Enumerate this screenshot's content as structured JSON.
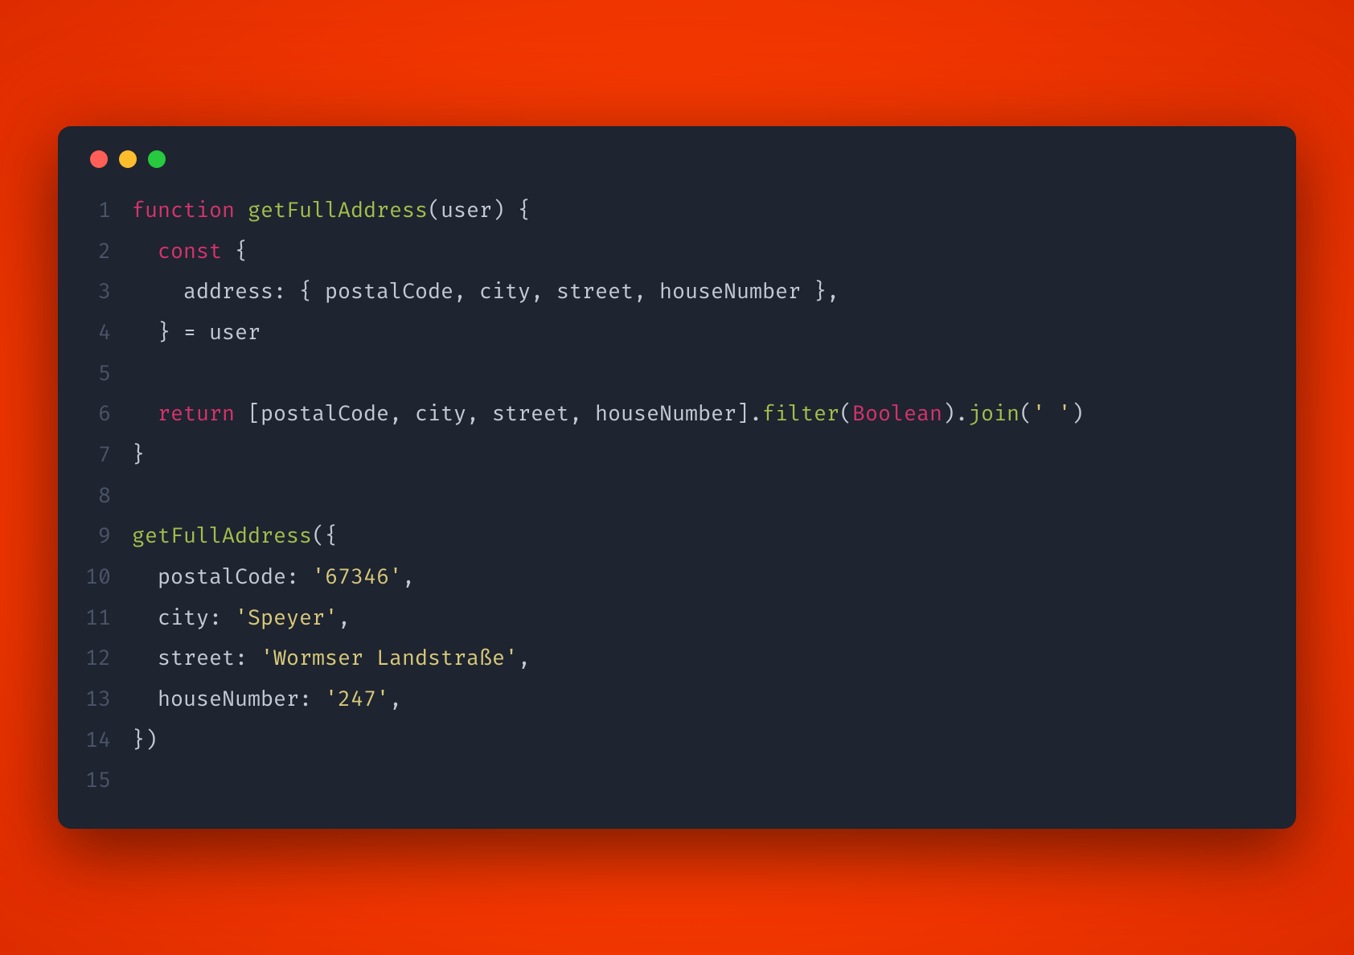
{
  "colors": {
    "background_gradient_inner": "#ff5722",
    "background_gradient_outer": "#dd2c00",
    "window_bg": "#1e2430",
    "line_number": "#4b5568",
    "default_text": "#c3c9d5",
    "keyword": "#d6336c",
    "function_name": "#a3be4c",
    "string": "#d8c97a",
    "traffic_red": "#ff5f56",
    "traffic_yellow": "#ffbd2e",
    "traffic_green": "#27c93f"
  },
  "code_lines": [
    {
      "n": 1,
      "tokens": [
        [
          "kw",
          "function"
        ],
        [
          "punct",
          " "
        ],
        [
          "fn",
          "getFullAddress"
        ],
        [
          "punct",
          "("
        ],
        [
          "punct",
          "user"
        ],
        [
          "punct",
          ") {"
        ]
      ]
    },
    {
      "n": 2,
      "tokens": [
        [
          "punct",
          "  "
        ],
        [
          "kw",
          "const"
        ],
        [
          "punct",
          " {"
        ]
      ]
    },
    {
      "n": 3,
      "tokens": [
        [
          "punct",
          "    address: { postalCode, city, street, houseNumber },"
        ]
      ]
    },
    {
      "n": 4,
      "tokens": [
        [
          "punct",
          "  } = user"
        ]
      ]
    },
    {
      "n": 5,
      "tokens": [
        [
          "punct",
          ""
        ]
      ]
    },
    {
      "n": 6,
      "tokens": [
        [
          "punct",
          "  "
        ],
        [
          "kw",
          "return"
        ],
        [
          "punct",
          " [postalCode, city, street, houseNumber]."
        ],
        [
          "method",
          "filter"
        ],
        [
          "punct",
          "("
        ],
        [
          "cls",
          "Boolean"
        ],
        [
          "punct",
          ")."
        ],
        [
          "method",
          "join"
        ],
        [
          "punct",
          "("
        ],
        [
          "str",
          "' '"
        ],
        [
          "punct",
          ")"
        ]
      ]
    },
    {
      "n": 7,
      "tokens": [
        [
          "punct",
          "}"
        ]
      ]
    },
    {
      "n": 8,
      "tokens": [
        [
          "punct",
          ""
        ]
      ]
    },
    {
      "n": 9,
      "tokens": [
        [
          "fn",
          "getFullAddress"
        ],
        [
          "punct",
          "({"
        ]
      ]
    },
    {
      "n": 10,
      "tokens": [
        [
          "punct",
          "  postalCode: "
        ],
        [
          "str",
          "'67346'"
        ],
        [
          "punct",
          ","
        ]
      ]
    },
    {
      "n": 11,
      "tokens": [
        [
          "punct",
          "  city: "
        ],
        [
          "str",
          "'Speyer'"
        ],
        [
          "punct",
          ","
        ]
      ]
    },
    {
      "n": 12,
      "tokens": [
        [
          "punct",
          "  street: "
        ],
        [
          "str",
          "'Wormser Landstraße'"
        ],
        [
          "punct",
          ","
        ]
      ]
    },
    {
      "n": 13,
      "tokens": [
        [
          "punct",
          "  houseNumber: "
        ],
        [
          "str",
          "'247'"
        ],
        [
          "punct",
          ","
        ]
      ]
    },
    {
      "n": 14,
      "tokens": [
        [
          "punct",
          "})"
        ]
      ]
    },
    {
      "n": 15,
      "tokens": [
        [
          "punct",
          ""
        ]
      ]
    }
  ]
}
